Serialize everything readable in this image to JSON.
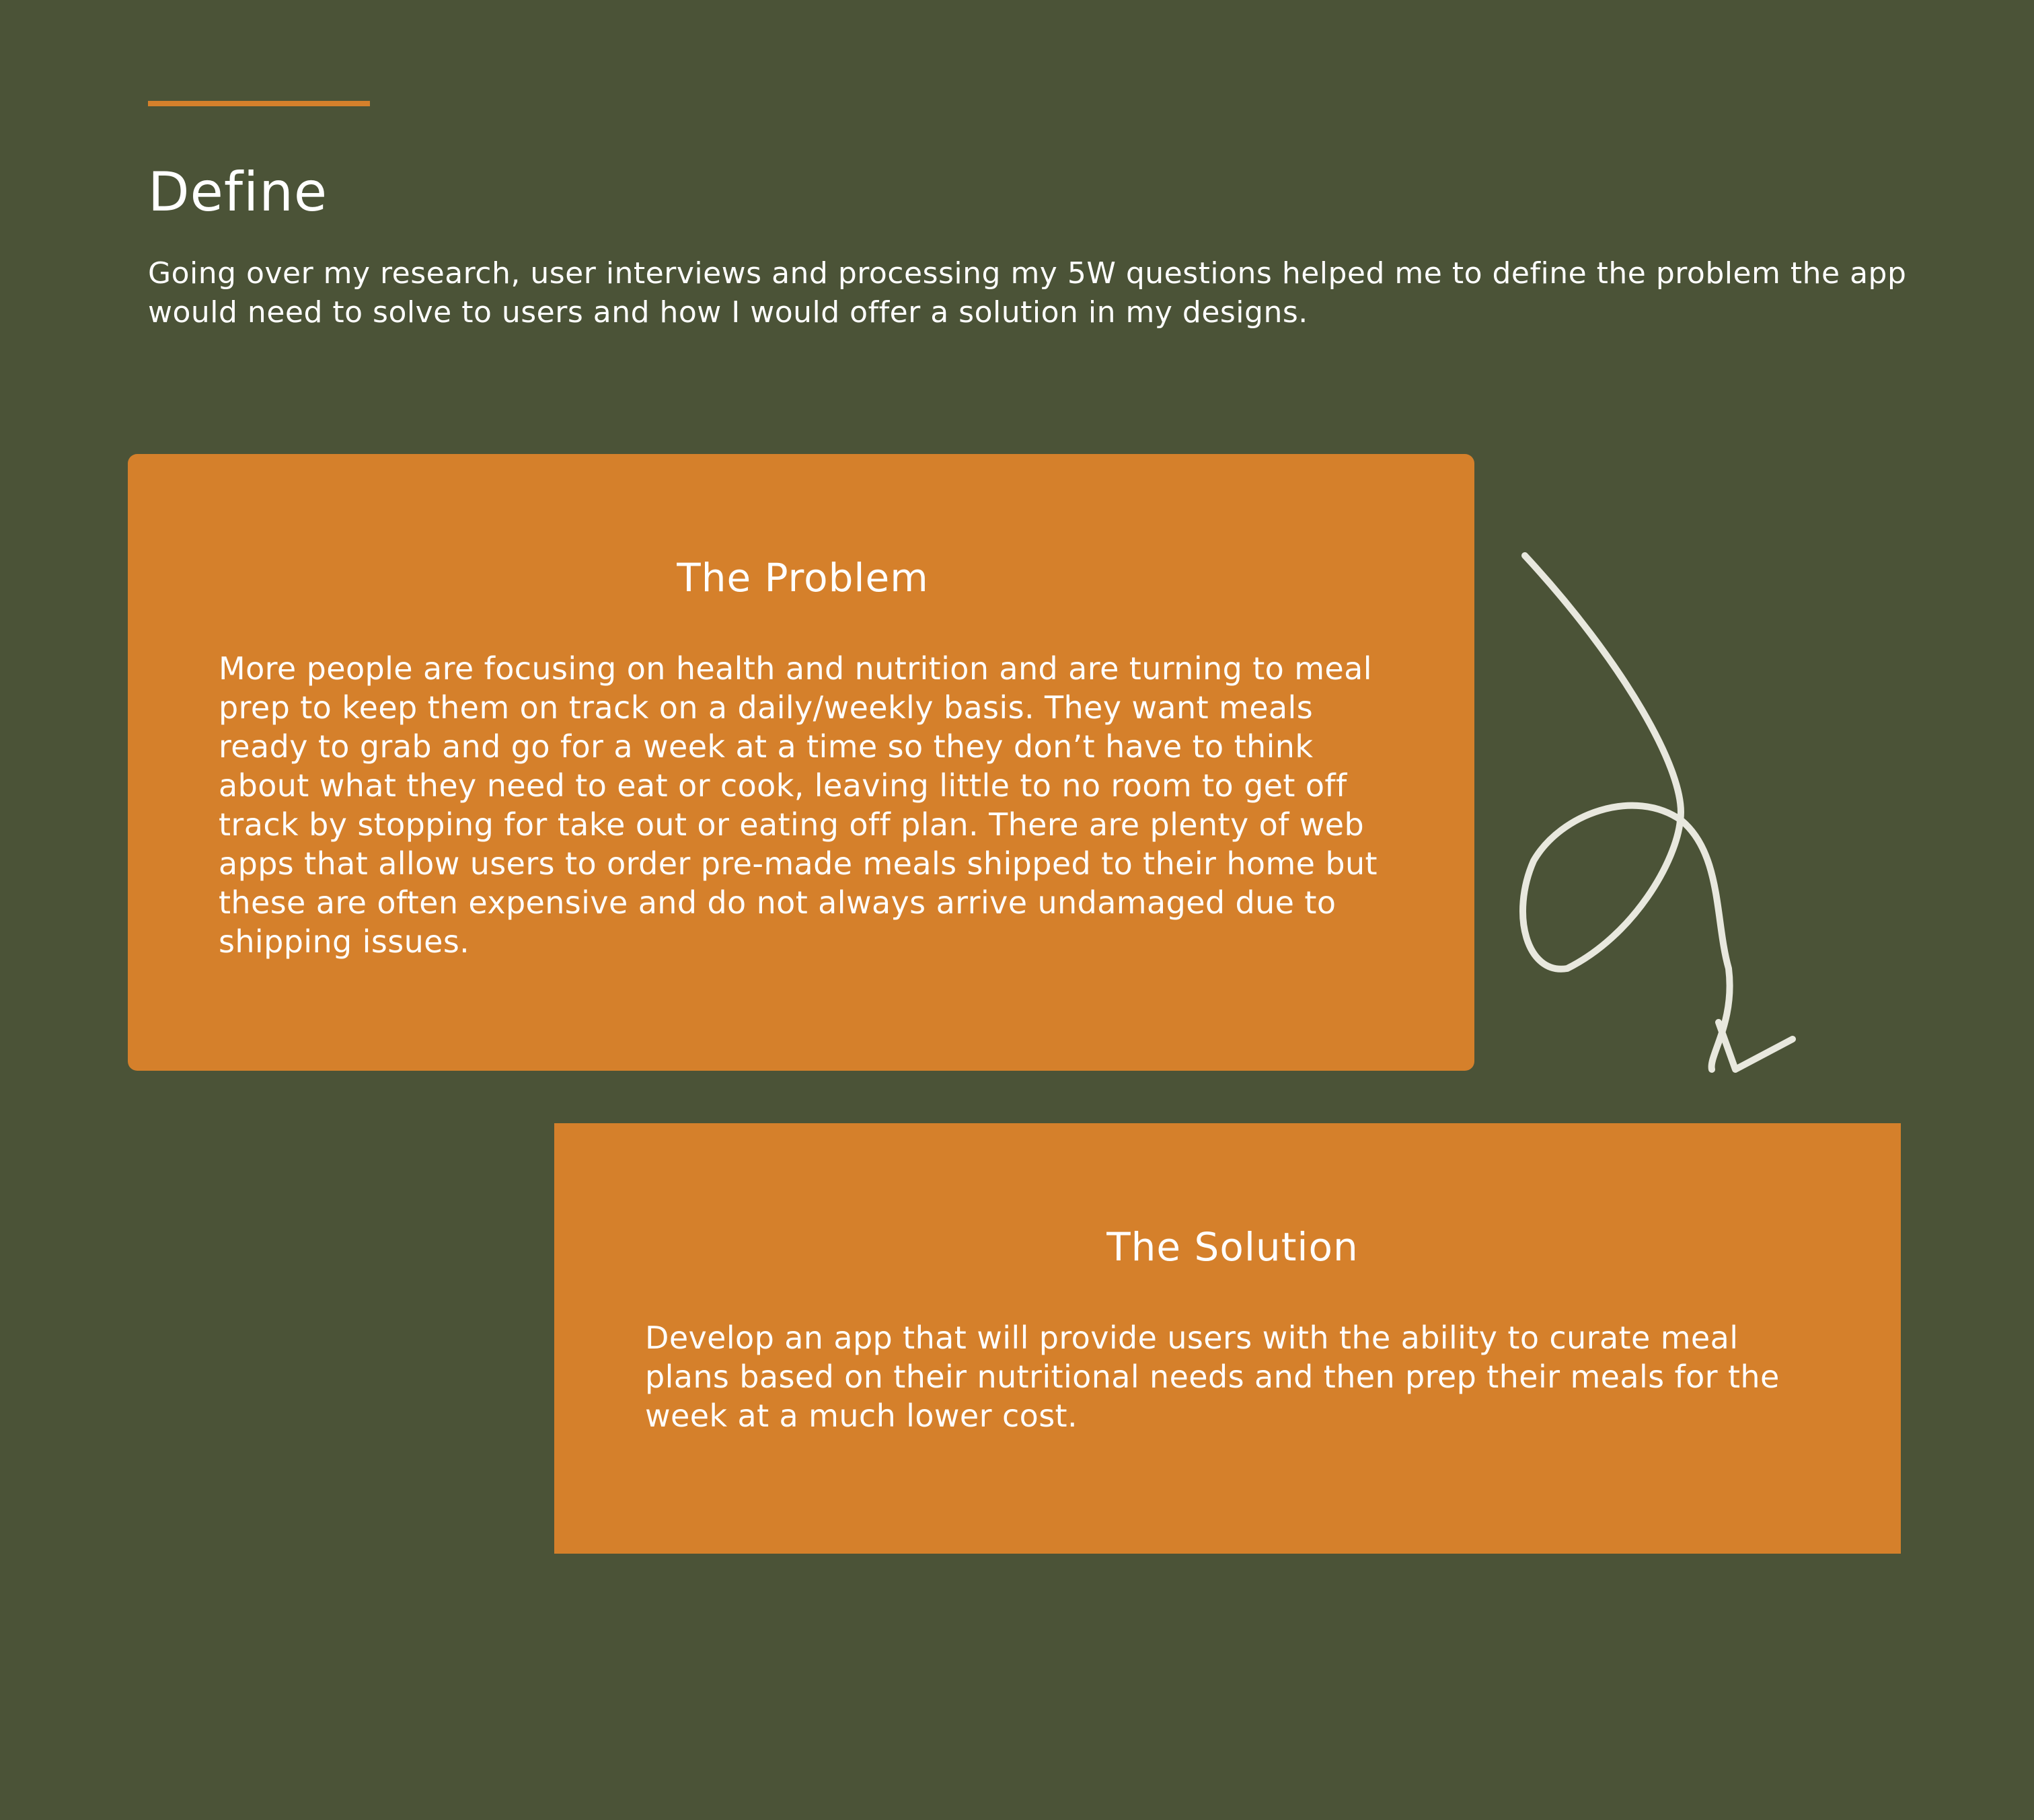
{
  "header": {
    "title": "Define",
    "intro": "Going over my research, user interviews and processing my 5W questions helped me to define the problem the app would need to solve to users and how I would offer a solution in my designs."
  },
  "problem": {
    "title": "The Problem",
    "body": "More people are focusing on health and nutrition and are turning to meal prep to keep them on track on a daily/weekly basis. They want meals ready to grab and go for a week at a time so they don’t have to think about what they need to eat or cook, leaving little to no room to get off track by stopping for take out or eating off plan. There are plenty of web apps that allow users to order pre-made meals shipped to their home but these are often expensive and do not always arrive undamaged due to shipping issues."
  },
  "solution": {
    "title": "The Solution",
    "body": "Develop an app that will provide users with the ability to curate meal plans based on their nutritional needs and then prep their meals for the week at a much lower cost."
  },
  "colors": {
    "background": "#4b5337",
    "accent": "#d5802b",
    "arrow": "#e8e8de"
  }
}
